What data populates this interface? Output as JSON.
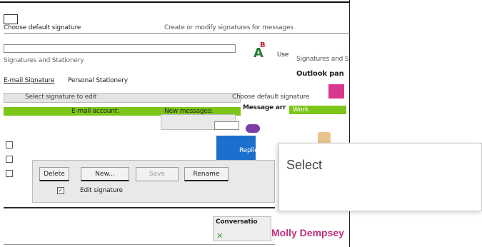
{
  "window": {
    "header_text_left": "Choose default signature",
    "header_text_right": "Create or modify signatures for messages",
    "sub_text": "Signatures and Stationery"
  },
  "tabs": {
    "email_signature": "E-mail Signature",
    "personal_stationery": "Personal Stationery"
  },
  "panels": {
    "select_to_edit": "Select signature to edit",
    "choose_default": "Choose default signature",
    "email_account": "E-mail account:",
    "new_messages": "New messages:",
    "replies_forwards": "Replies/forwards:",
    "edit_signature": "Edit signature",
    "outlook_panel": "Outlook pan",
    "message_arr": "Message arr",
    "conversation": "Conversatio",
    "signatures_right": "Signatures and S",
    "use_text": "Use"
  },
  "buttons": {
    "delete": "Delete",
    "new": "New...",
    "save": "Save",
    "rename": "Rename"
  },
  "tags": {
    "work": "Work"
  },
  "contact": {
    "name": "Molly Dempsey"
  },
  "popup": {
    "label": "Select"
  },
  "colors": {
    "accent_green": "#7cc519",
    "accent_blue": "#1c6fcc",
    "accent_orange": "#f3a64a",
    "name_pink": "#c0317c"
  }
}
